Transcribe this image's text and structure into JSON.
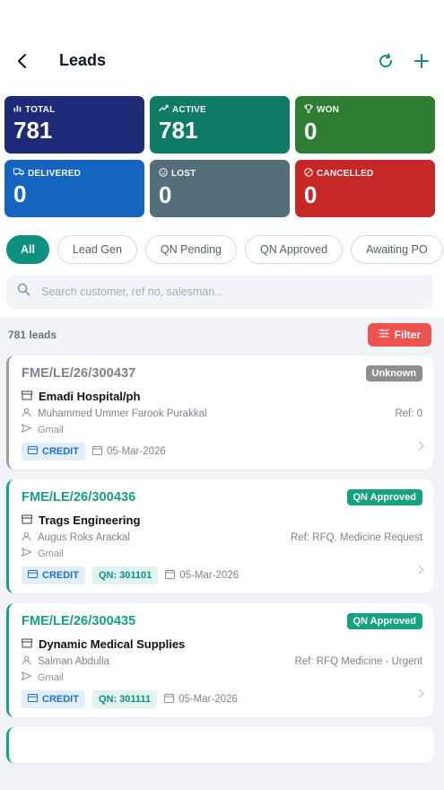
{
  "header": {
    "title": "Leads"
  },
  "stats": [
    {
      "key": "total",
      "label": "TOTAL",
      "value": "781",
      "icon": "bar-chart-icon"
    },
    {
      "key": "active",
      "label": "ACTIVE",
      "value": "781",
      "icon": "trending-up-icon"
    },
    {
      "key": "won",
      "label": "WON",
      "value": "0",
      "icon": "trophy-icon"
    },
    {
      "key": "delivered",
      "label": "DELIVERED",
      "value": "0",
      "icon": "truck-icon"
    },
    {
      "key": "lost",
      "label": "LOST",
      "value": "0",
      "icon": "sad-face-icon"
    },
    {
      "key": "cancelled",
      "label": "CANCELLED",
      "value": "0",
      "icon": "cancel-icon"
    }
  ],
  "chips": [
    "All",
    "Lead Gen",
    "QN Pending",
    "QN Approved",
    "Awaiting PO"
  ],
  "search": {
    "placeholder": "Search customer, ref no, salesman..."
  },
  "list": {
    "count": "781 leads",
    "filter_label": "Filter"
  },
  "leads": [
    {
      "ref": "FME/LE/26/300437",
      "status": "Unknown",
      "customer": "Emadi Hospital/ph",
      "salesman": "Muhammed Ummer Farook Purakkal",
      "ref_note": "Ref: 0",
      "source": "Gmail",
      "payment": "CREDIT",
      "qn": "",
      "date": "05-Mar-2026"
    },
    {
      "ref": "FME/LE/26/300436",
      "status": "QN Approved",
      "customer": "Trags Engineering",
      "salesman": "Augus Roks Arackal",
      "ref_note": "Ref: RFQ, Medicine Request",
      "source": "Gmail",
      "payment": "CREDIT",
      "qn": "QN: 301101",
      "date": "05-Mar-2026"
    },
    {
      "ref": "FME/LE/26/300435",
      "status": "QN Approved",
      "customer": "Dynamic Medical Supplies",
      "salesman": "Salman Abdulla",
      "ref_note": "Ref: RFQ Medicine - Urgent",
      "source": "Gmail",
      "payment": "CREDIT",
      "qn": "QN: 301111",
      "date": "05-Mar-2026"
    }
  ],
  "colors": {
    "accent": "#0f8f7f",
    "filter": "#ef5350",
    "total": "#1e2a78",
    "active": "#0f7b66",
    "won": "#2e7d32",
    "delivered": "#1565c0",
    "lost": "#546e7a",
    "cancelled": "#c62828"
  }
}
